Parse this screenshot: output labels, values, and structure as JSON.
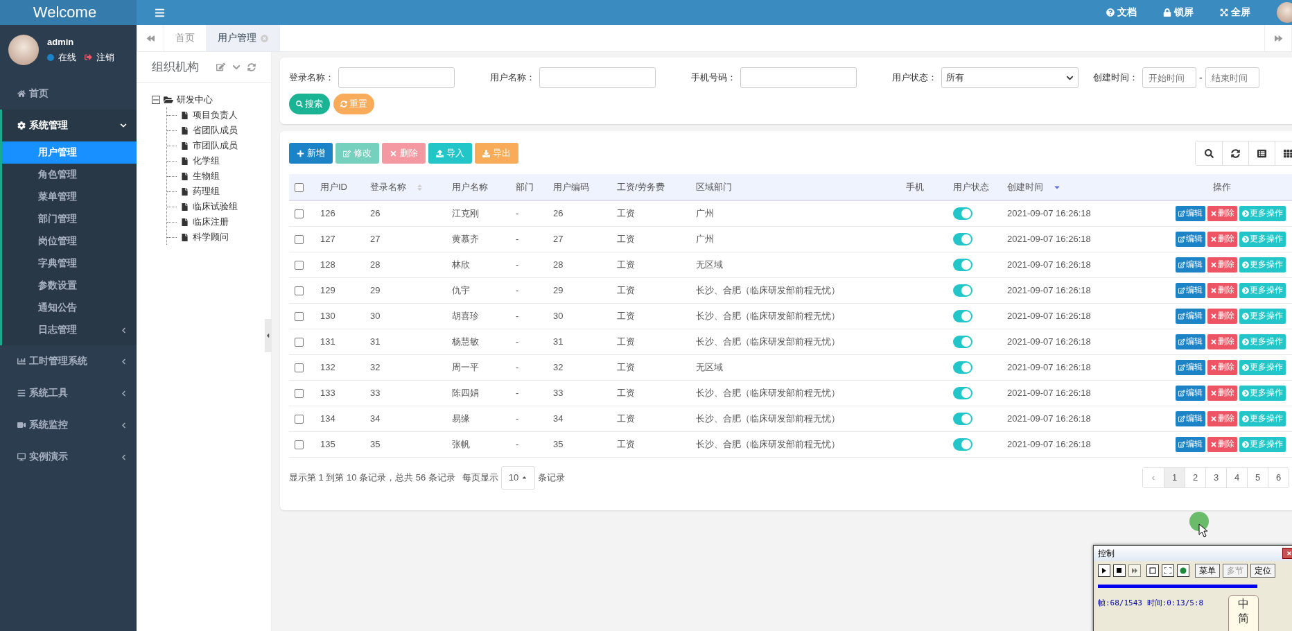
{
  "header": {
    "brand": "Welcome",
    "links": [
      {
        "label": "文档",
        "kind": "help"
      },
      {
        "label": "锁屏",
        "kind": "lock"
      },
      {
        "label": "全屏",
        "kind": "fullscreen"
      }
    ]
  },
  "user": {
    "name": "admin",
    "status": "在线",
    "logout": "注销"
  },
  "sidebar": {
    "items": [
      {
        "label": "首页",
        "kind": "link"
      },
      {
        "label": "系统管理",
        "kind": "menu",
        "expanded": true,
        "children": [
          {
            "label": "用户管理",
            "selected": true
          },
          {
            "label": "角色管理",
            "selected": false
          },
          {
            "label": "菜单管理",
            "selected": false
          },
          {
            "label": "部门管理",
            "selected": false
          },
          {
            "label": "岗位管理",
            "selected": false
          },
          {
            "label": "字典管理",
            "selected": false
          },
          {
            "label": "参数设置",
            "selected": false
          },
          {
            "label": "通知公告",
            "selected": false
          },
          {
            "label": "日志管理",
            "selected": false,
            "expanded": false
          }
        ]
      },
      {
        "label": "工时管理系统",
        "kind": "menu",
        "expanded": false
      },
      {
        "label": "系统工具",
        "kind": "menu",
        "expanded": false
      },
      {
        "label": "系统监控",
        "kind": "menu",
        "expanded": false
      },
      {
        "label": "实例演示",
        "kind": "menu",
        "expanded": false
      }
    ]
  },
  "tabs": [
    {
      "label": "首页",
      "selected": false
    },
    {
      "label": "用户管理",
      "selected": true
    }
  ],
  "tree": {
    "title": "组织机构",
    "root": {
      "label": "研发中心",
      "expanded": true,
      "children": [
        {
          "label": "项目负责人"
        },
        {
          "label": "省团队成员"
        },
        {
          "label": "市团队成员"
        },
        {
          "label": "化学组"
        },
        {
          "label": "生物组"
        },
        {
          "label": "药理组"
        },
        {
          "label": "临床试验组"
        },
        {
          "label": "临床注册"
        },
        {
          "label": "科学顾问"
        }
      ]
    }
  },
  "filters": {
    "fields": [
      {
        "label": "登录名称：",
        "kind": "text"
      },
      {
        "label": "用户名称：",
        "kind": "text"
      },
      {
        "label": "手机号码：",
        "kind": "text"
      },
      {
        "label": "用户状态：",
        "kind": "select",
        "value": "所有"
      },
      {
        "label": "创建时间：",
        "kind": "daterange",
        "start_placeholder": "开始时间",
        "separator": "-",
        "end_placeholder": "结束时间"
      }
    ],
    "buttons": [
      {
        "label": "搜索",
        "kind": "search"
      },
      {
        "label": "重置",
        "kind": "reset"
      }
    ]
  },
  "toolbar": {
    "buttons": [
      {
        "label": "新增",
        "kind": "add",
        "disabled": false
      },
      {
        "label": "修改",
        "kind": "edit",
        "disabled": true
      },
      {
        "label": "删除",
        "kind": "remove",
        "disabled": true
      },
      {
        "label": "导入",
        "kind": "import",
        "disabled": false
      },
      {
        "label": "导出",
        "kind": "export",
        "disabled": false
      }
    ]
  },
  "table": {
    "all_checked": false,
    "columns": [
      {
        "label": "用户ID"
      },
      {
        "label": "登录名称",
        "sortable": true
      },
      {
        "label": "用户名称"
      },
      {
        "label": "部门"
      },
      {
        "label": "用户编码"
      },
      {
        "label": "工资/劳务费"
      },
      {
        "label": "区域部门"
      },
      {
        "label": "手机"
      },
      {
        "label": "用户状态"
      },
      {
        "label": "创建时间",
        "sorted_descending": true
      },
      {
        "label": "操作"
      }
    ],
    "rows": [
      {
        "checked": false,
        "id": "126",
        "login": "26",
        "name": "江克刚",
        "dept": "-",
        "code": "26",
        "pay": "工资",
        "region": "广州",
        "enabled": true,
        "created": "2021-09-07 16:26:18",
        "actions": [
          "编辑",
          "删除",
          "更多操作"
        ]
      },
      {
        "checked": false,
        "id": "127",
        "login": "27",
        "name": "黄慕齐",
        "dept": "-",
        "code": "27",
        "pay": "工资",
        "region": "广州",
        "enabled": true,
        "created": "2021-09-07 16:26:18",
        "actions": [
          "编辑",
          "删除",
          "更多操作"
        ]
      },
      {
        "checked": false,
        "id": "128",
        "login": "28",
        "name": "林欣",
        "dept": "-",
        "code": "28",
        "pay": "工资",
        "region": "无区域",
        "enabled": true,
        "created": "2021-09-07 16:26:18",
        "actions": [
          "编辑",
          "删除",
          "更多操作"
        ]
      },
      {
        "checked": false,
        "id": "129",
        "login": "29",
        "name": "仇宇",
        "dept": "-",
        "code": "29",
        "pay": "工资",
        "region": "长沙、合肥（临床研发部前程无忧）",
        "enabled": true,
        "created": "2021-09-07 16:26:18",
        "actions": [
          "编辑",
          "删除",
          "更多操作"
        ]
      },
      {
        "checked": false,
        "id": "130",
        "login": "30",
        "name": "胡喜珍",
        "dept": "-",
        "code": "30",
        "pay": "工资",
        "region": "长沙、合肥（临床研发部前程无忧）",
        "enabled": true,
        "created": "2021-09-07 16:26:18",
        "actions": [
          "编辑",
          "删除",
          "更多操作"
        ]
      },
      {
        "checked": false,
        "id": "131",
        "login": "31",
        "name": "杨慧敏",
        "dept": "-",
        "code": "31",
        "pay": "工资",
        "region": "长沙、合肥（临床研发部前程无忧）",
        "enabled": true,
        "created": "2021-09-07 16:26:18",
        "actions": [
          "编辑",
          "删除",
          "更多操作"
        ]
      },
      {
        "checked": false,
        "id": "132",
        "login": "32",
        "name": "周一平",
        "dept": "-",
        "code": "32",
        "pay": "工资",
        "region": "无区域",
        "enabled": true,
        "created": "2021-09-07 16:26:18",
        "actions": [
          "编辑",
          "删除",
          "更多操作"
        ]
      },
      {
        "checked": false,
        "id": "133",
        "login": "33",
        "name": "陈四娟",
        "dept": "-",
        "code": "33",
        "pay": "工资",
        "region": "长沙、合肥（临床研发部前程无忧）",
        "enabled": true,
        "created": "2021-09-07 16:26:18",
        "actions": [
          "编辑",
          "删除",
          "更多操作"
        ]
      },
      {
        "checked": false,
        "id": "134",
        "login": "34",
        "name": "易缘",
        "dept": "-",
        "code": "34",
        "pay": "工资",
        "region": "长沙、合肥（临床研发部前程无忧）",
        "enabled": true,
        "created": "2021-09-07 16:26:18",
        "actions": [
          "编辑",
          "删除",
          "更多操作"
        ]
      },
      {
        "checked": false,
        "id": "135",
        "login": "35",
        "name": "张帆",
        "dept": "-",
        "code": "35",
        "pay": "工资",
        "region": "长沙、合肥（临床研发部前程无忧）",
        "enabled": true,
        "created": "2021-09-07 16:26:18",
        "actions": [
          "编辑",
          "删除",
          "更多操作"
        ]
      }
    ]
  },
  "pagination": {
    "summary": "显示第 1 到第 10 条记录，总共 56 条记录",
    "per_page_label": "每页显示",
    "page_size": "10",
    "per_page_suffix": "条记录",
    "prev": "‹",
    "pages": [
      {
        "label": "1",
        "selected": true
      },
      {
        "label": "2",
        "selected": false
      },
      {
        "label": "3",
        "selected": false
      },
      {
        "label": "4",
        "selected": false
      },
      {
        "label": "5",
        "selected": false
      },
      {
        "label": "6",
        "selected": false
      }
    ]
  },
  "control_window": {
    "title": "控制",
    "buttons": [
      {
        "label": "菜单",
        "disabled": false
      },
      {
        "label": "多节",
        "disabled": true
      },
      {
        "label": "定位",
        "disabled": false
      }
    ],
    "status": "帧:68/1543 时间:0:13/5:8",
    "sticker": [
      "中",
      "简"
    ]
  }
}
